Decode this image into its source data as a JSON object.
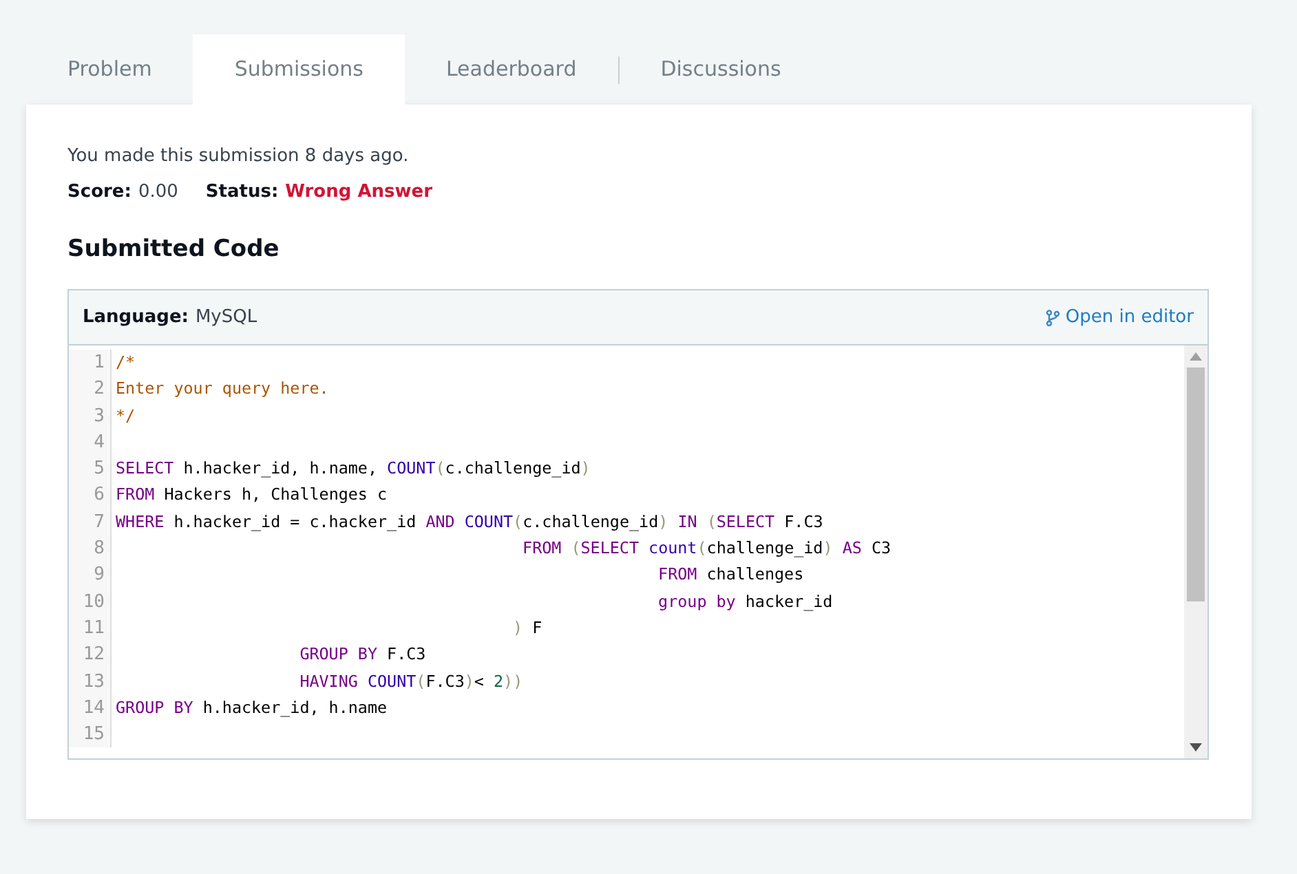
{
  "tabs": [
    {
      "label": "Problem",
      "selected": false
    },
    {
      "label": "Submissions",
      "selected": true
    },
    {
      "label": "Leaderboard",
      "selected": false
    },
    {
      "label": "Discussions",
      "selected": false
    }
  ],
  "submission_note": "You made this submission 8 days ago.",
  "score": {
    "label": "Score:",
    "value": "0.00"
  },
  "status": {
    "label": "Status:",
    "value": "Wrong Answer"
  },
  "section_title": "Submitted Code",
  "editor": {
    "language_label": "Language:",
    "language": "MySQL",
    "open_link": "Open in editor",
    "lines": [
      {
        "number": "1",
        "tokens": [
          {
            "kind": "comment",
            "text": "/*"
          }
        ]
      },
      {
        "number": "2",
        "tokens": [
          {
            "kind": "comment",
            "text": "Enter your query here."
          }
        ]
      },
      {
        "number": "3",
        "tokens": [
          {
            "kind": "comment",
            "text": "*/"
          }
        ]
      },
      {
        "number": "4"
      },
      {
        "number": "5",
        "tokens": [
          {
            "kind": "keyword",
            "text": "SELECT"
          },
          {
            "kind": "plain",
            "text": " h.hacker_id, h.name, "
          },
          {
            "kind": "builtin",
            "text": "COUNT"
          },
          {
            "kind": "bracket",
            "text": "("
          },
          {
            "kind": "plain",
            "text": "c.challenge_id"
          },
          {
            "kind": "bracket",
            "text": ")"
          }
        ]
      },
      {
        "number": "6",
        "tokens": [
          {
            "kind": "keyword",
            "text": "FROM"
          },
          {
            "kind": "plain",
            "text": " Hackers h, Challenges c"
          }
        ]
      },
      {
        "number": "7",
        "tokens": [
          {
            "kind": "keyword",
            "text": "WHERE"
          },
          {
            "kind": "plain",
            "text": " h.hacker_id = c.hacker_id "
          },
          {
            "kind": "keyword",
            "text": "AND"
          },
          {
            "kind": "builtin",
            "text": " COUNT"
          },
          {
            "kind": "bracket",
            "text": "("
          },
          {
            "kind": "plain",
            "text": "c.challenge_id"
          },
          {
            "kind": "bracket",
            "text": ")"
          },
          {
            "kind": "keyword",
            "text": " IN"
          },
          {
            "kind": "bracket",
            "text": " ("
          },
          {
            "kind": "keyword",
            "text": "SELECT"
          },
          {
            "kind": "plain",
            "text": " F.C3"
          }
        ]
      },
      {
        "number": "8",
        "tokens": [
          {
            "kind": "keyword",
            "text": "                                          FROM"
          },
          {
            "kind": "bracket",
            "text": " ("
          },
          {
            "kind": "keyword",
            "text": "SELECT"
          },
          {
            "kind": "builtin",
            "text": " count"
          },
          {
            "kind": "bracket",
            "text": "("
          },
          {
            "kind": "plain",
            "text": "challenge_id"
          },
          {
            "kind": "bracket",
            "text": ")"
          },
          {
            "kind": "keyword",
            "text": " AS"
          },
          {
            "kind": "plain",
            "text": " C3"
          }
        ]
      },
      {
        "number": "9",
        "tokens": [
          {
            "kind": "keyword",
            "text": "                                                        FROM"
          },
          {
            "kind": "plain",
            "text": " challenges"
          }
        ]
      },
      {
        "number": "10",
        "tokens": [
          {
            "kind": "keyword",
            "text": "                                                        group by"
          },
          {
            "kind": "plain",
            "text": " hacker_id"
          }
        ]
      },
      {
        "number": "11",
        "tokens": [
          {
            "kind": "bracket",
            "text": "                                         )"
          },
          {
            "kind": "plain",
            "text": " F"
          }
        ]
      },
      {
        "number": "12",
        "tokens": [
          {
            "kind": "keyword",
            "text": "                   GROUP BY"
          },
          {
            "kind": "plain",
            "text": " F.C3"
          }
        ]
      },
      {
        "number": "13",
        "tokens": [
          {
            "kind": "keyword",
            "text": "                   HAVING"
          },
          {
            "kind": "builtin",
            "text": " COUNT"
          },
          {
            "kind": "bracket",
            "text": "("
          },
          {
            "kind": "plain",
            "text": "F.C3"
          },
          {
            "kind": "bracket",
            "text": ")"
          },
          {
            "kind": "plain",
            "text": "< "
          },
          {
            "kind": "number",
            "text": "2"
          },
          {
            "kind": "bracket",
            "text": "))"
          }
        ]
      },
      {
        "number": "14",
        "tokens": [
          {
            "kind": "keyword",
            "text": "GROUP BY"
          },
          {
            "kind": "plain",
            "text": " h.hacker_id, h.name"
          }
        ]
      },
      {
        "number": "15"
      }
    ]
  }
}
